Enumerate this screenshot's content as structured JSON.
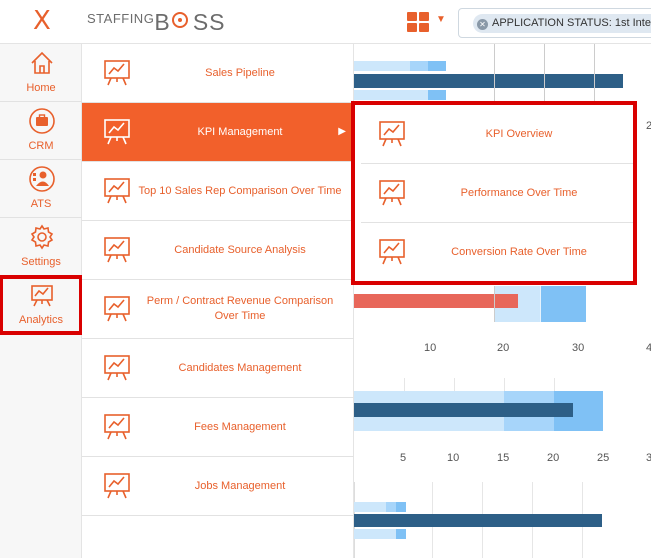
{
  "topbar": {
    "logo_small": "STAFFING",
    "logo_big_b": "B",
    "logo_big_rest": "SS",
    "filter_chip": "APPLICATION STATUS: 1st Intervi"
  },
  "leftnav": [
    {
      "label": "Home",
      "icon": "home-icon"
    },
    {
      "label": "CRM",
      "icon": "briefcase-icon"
    },
    {
      "label": "ATS",
      "icon": "people-icon"
    },
    {
      "label": "Settings",
      "icon": "gear-icon"
    },
    {
      "label": "Analytics",
      "icon": "analytics-icon"
    }
  ],
  "menu": [
    {
      "label": "Sales Pipeline"
    },
    {
      "label": "KPI Management"
    },
    {
      "label": "Top 10 Sales Rep Comparison Over Time"
    },
    {
      "label": "Candidate Source Analysis"
    },
    {
      "label": "Perm / Contract Revenue Comparison Over Time"
    },
    {
      "label": "Candidates Management"
    },
    {
      "label": "Fees Management"
    },
    {
      "label": "Jobs Management"
    }
  ],
  "submenu": [
    {
      "label": "KPI Overview"
    },
    {
      "label": "Performance Over Time"
    },
    {
      "label": "Conversion Rate Over Time"
    }
  ],
  "axis1_ticks": [
    "10",
    "20",
    "30",
    "4"
  ],
  "axis2_ticks": [
    "5",
    "10",
    "15",
    "20",
    "25",
    "3"
  ],
  "edge_label": "2",
  "colors": {
    "accent": "#e8602c",
    "highlight": "#d90000",
    "bar_dark": "#2d5f87",
    "bar_light": "#7fc1f5",
    "bar_pale": "#cde7fb",
    "bar_red": "#e8675a"
  }
}
